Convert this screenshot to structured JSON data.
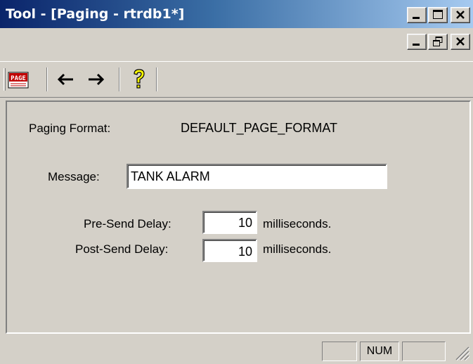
{
  "window": {
    "title": "Tool - [Paging - rtrdb1*]"
  },
  "toolbar": {
    "page_icon_text": "PAGE"
  },
  "form": {
    "paging_format_label": "Paging Format:",
    "paging_format_value": "DEFAULT_PAGE_FORMAT",
    "message_label": "Message:",
    "message_value": "TANK ALARM",
    "pre_send_label": "Pre-Send Delay:",
    "pre_send_value": "10",
    "pre_send_unit": "milliseconds.",
    "post_send_label": "Post-Send Delay:",
    "post_send_value": "10",
    "post_send_unit": "milliseconds."
  },
  "statusbar": {
    "num_indicator": "NUM"
  },
  "colors": {
    "title_gradient_start": "#0a246a",
    "title_gradient_end": "#a6caf0",
    "face": "#d4d0c8",
    "page_icon_red": "#c00000",
    "help_icon_yellow": "#ffff00"
  }
}
